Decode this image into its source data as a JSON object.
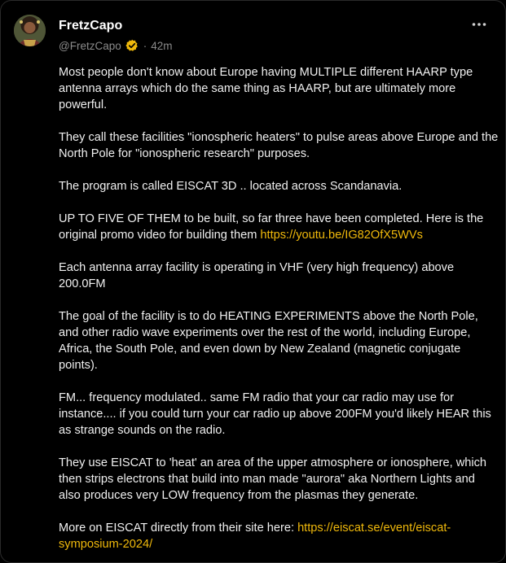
{
  "post": {
    "author_name": "FretzCapo",
    "handle": "@FretzCapo",
    "separator": "·",
    "time": "42m",
    "paragraphs": [
      {
        "text": "Most people don't know about Europe having MULTIPLE different HAARP type antenna arrays which do the same thing as HAARP, but are ultimately more powerful."
      },
      {
        "text": "They call these facilities \"ionospheric heaters\" to pulse areas above Europe and the North Pole for \"ionospheric research\" purposes."
      },
      {
        "text": "The program is called EISCAT 3D .. located across Scandanavia."
      },
      {
        "text": "UP TO FIVE OF THEM to be built, so far three have been completed. Here is the original promo video for building them ",
        "link": "https://youtu.be/IG82OfX5WVs"
      },
      {
        "text": "Each antenna array facility is operating in VHF (very high frequency) above 200.0FM"
      },
      {
        "text": "The goal of the facility is to do HEATING EXPERIMENTS above the North Pole, and other radio wave experiments over the rest of the world, including Europe, Africa, the South Pole, and even down by New Zealand (magnetic conjugate points)."
      },
      {
        "text": "FM... frequency modulated.. same FM radio that your car radio may use for instance.... if you could turn your car radio up above 200FM you'd likely HEAR this as strange sounds on the radio."
      },
      {
        "text": "They use EISCAT to 'heat' an area of the upper atmosphere or ionosphere, which then strips electrons that build into man made \"aurora\" aka Northern Lights and also produces very LOW frequency from the plasmas they generate."
      },
      {
        "text": "More on EISCAT directly from their site here: ",
        "link": "https://eiscat.se/event/eiscat-symposium-2024/"
      }
    ]
  },
  "icons": {
    "avatar": "avatar-image",
    "verified": "verified-badge-icon",
    "more": "more-options-icon"
  },
  "colors": {
    "background": "#000000",
    "text": "#f0f0f0",
    "muted": "#8b8b8b",
    "link": "#f0b90b",
    "verified": "#f0b90b"
  }
}
